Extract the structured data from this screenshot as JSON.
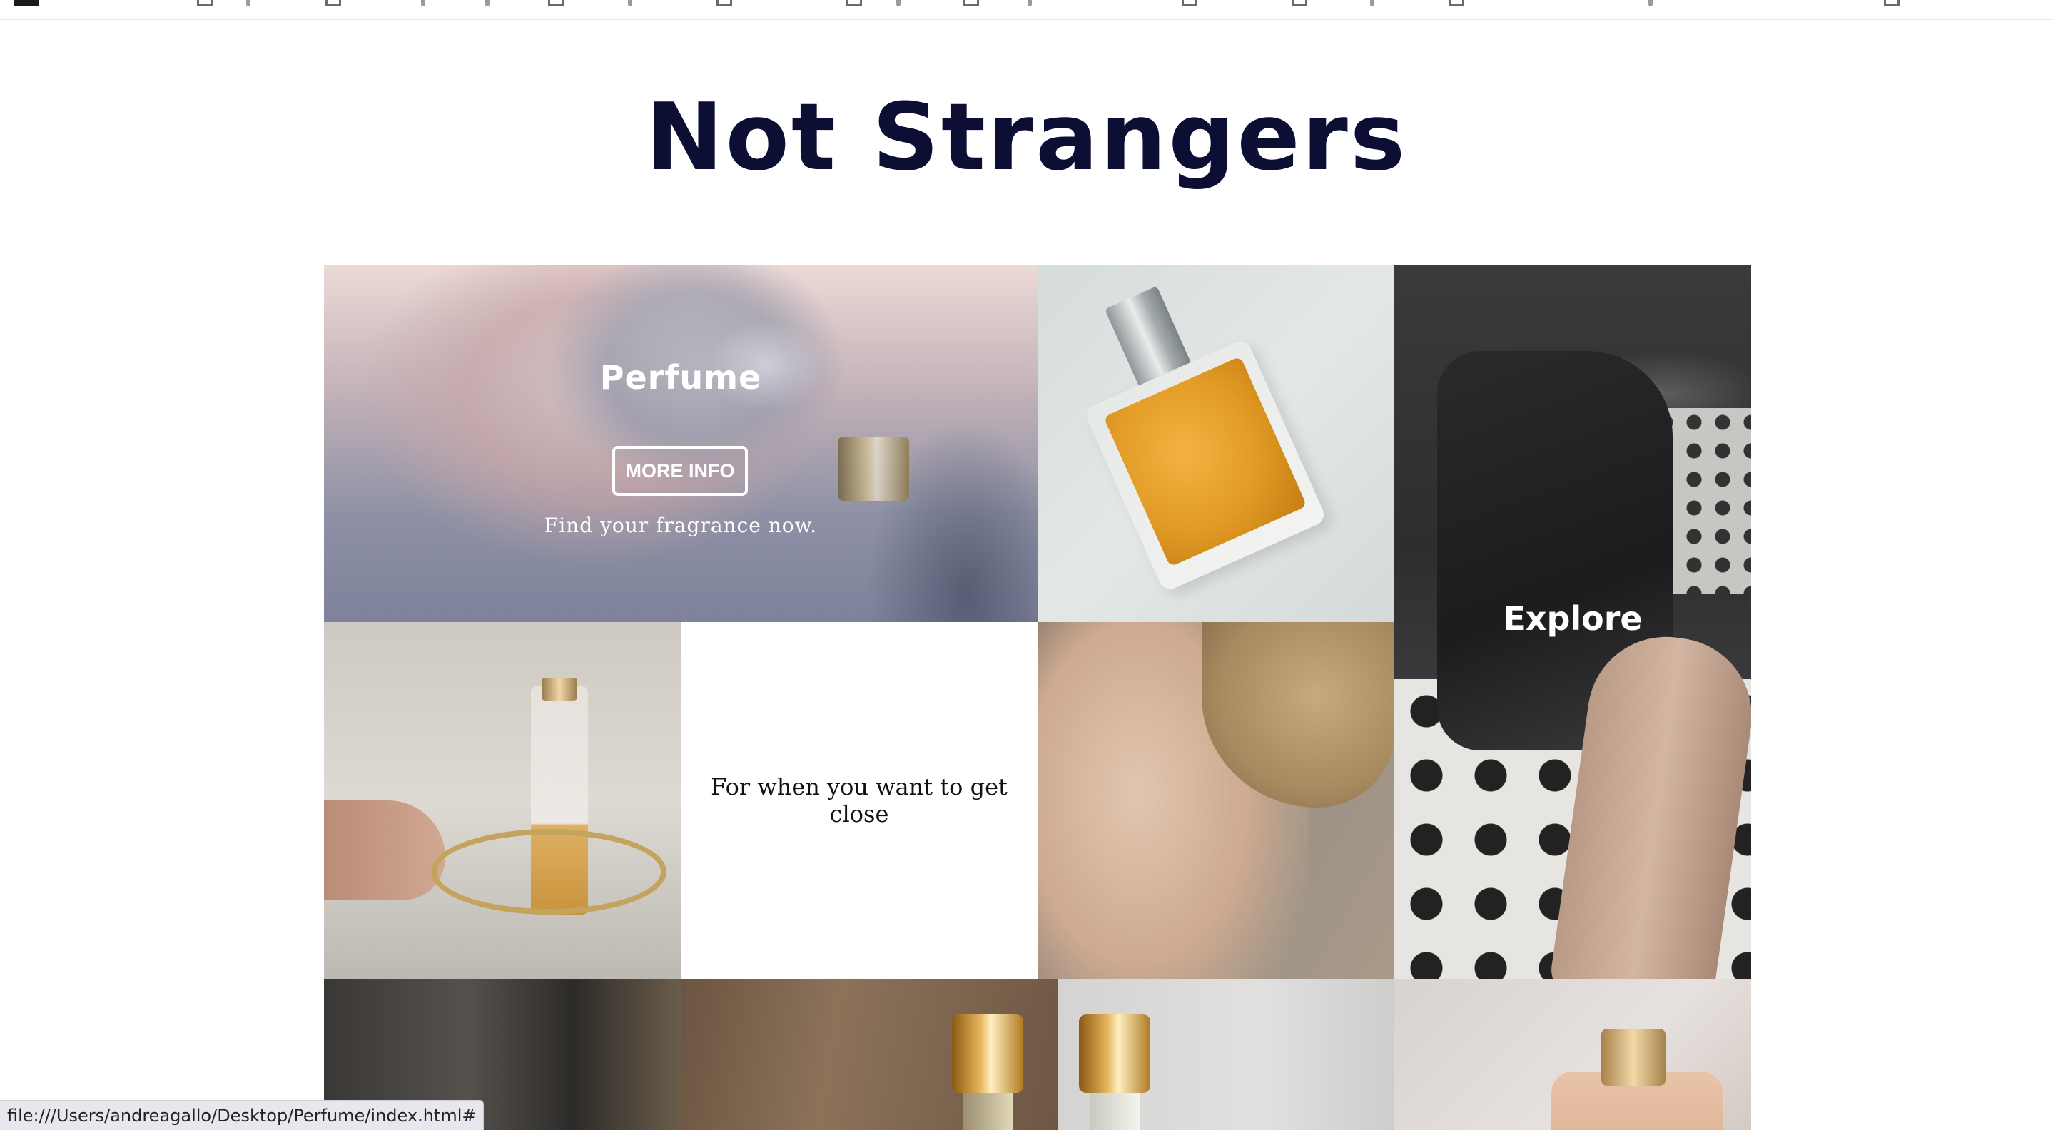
{
  "site": {
    "title": "Not Strangers"
  },
  "gallery": {
    "perfume_tile": {
      "heading": "Perfume",
      "button_label": "MORE INFO",
      "tagline": "Find your fragrance now."
    },
    "explore_tile": {
      "heading": "Explore"
    },
    "text_tile": {
      "text": "For when you want to get close"
    }
  },
  "status_bar": {
    "url": "file:///Users/andreagallo/Desktop/Perfume/index.html#"
  },
  "colors": {
    "title": "#0c0e33",
    "overlay_text": "#ffffff"
  }
}
